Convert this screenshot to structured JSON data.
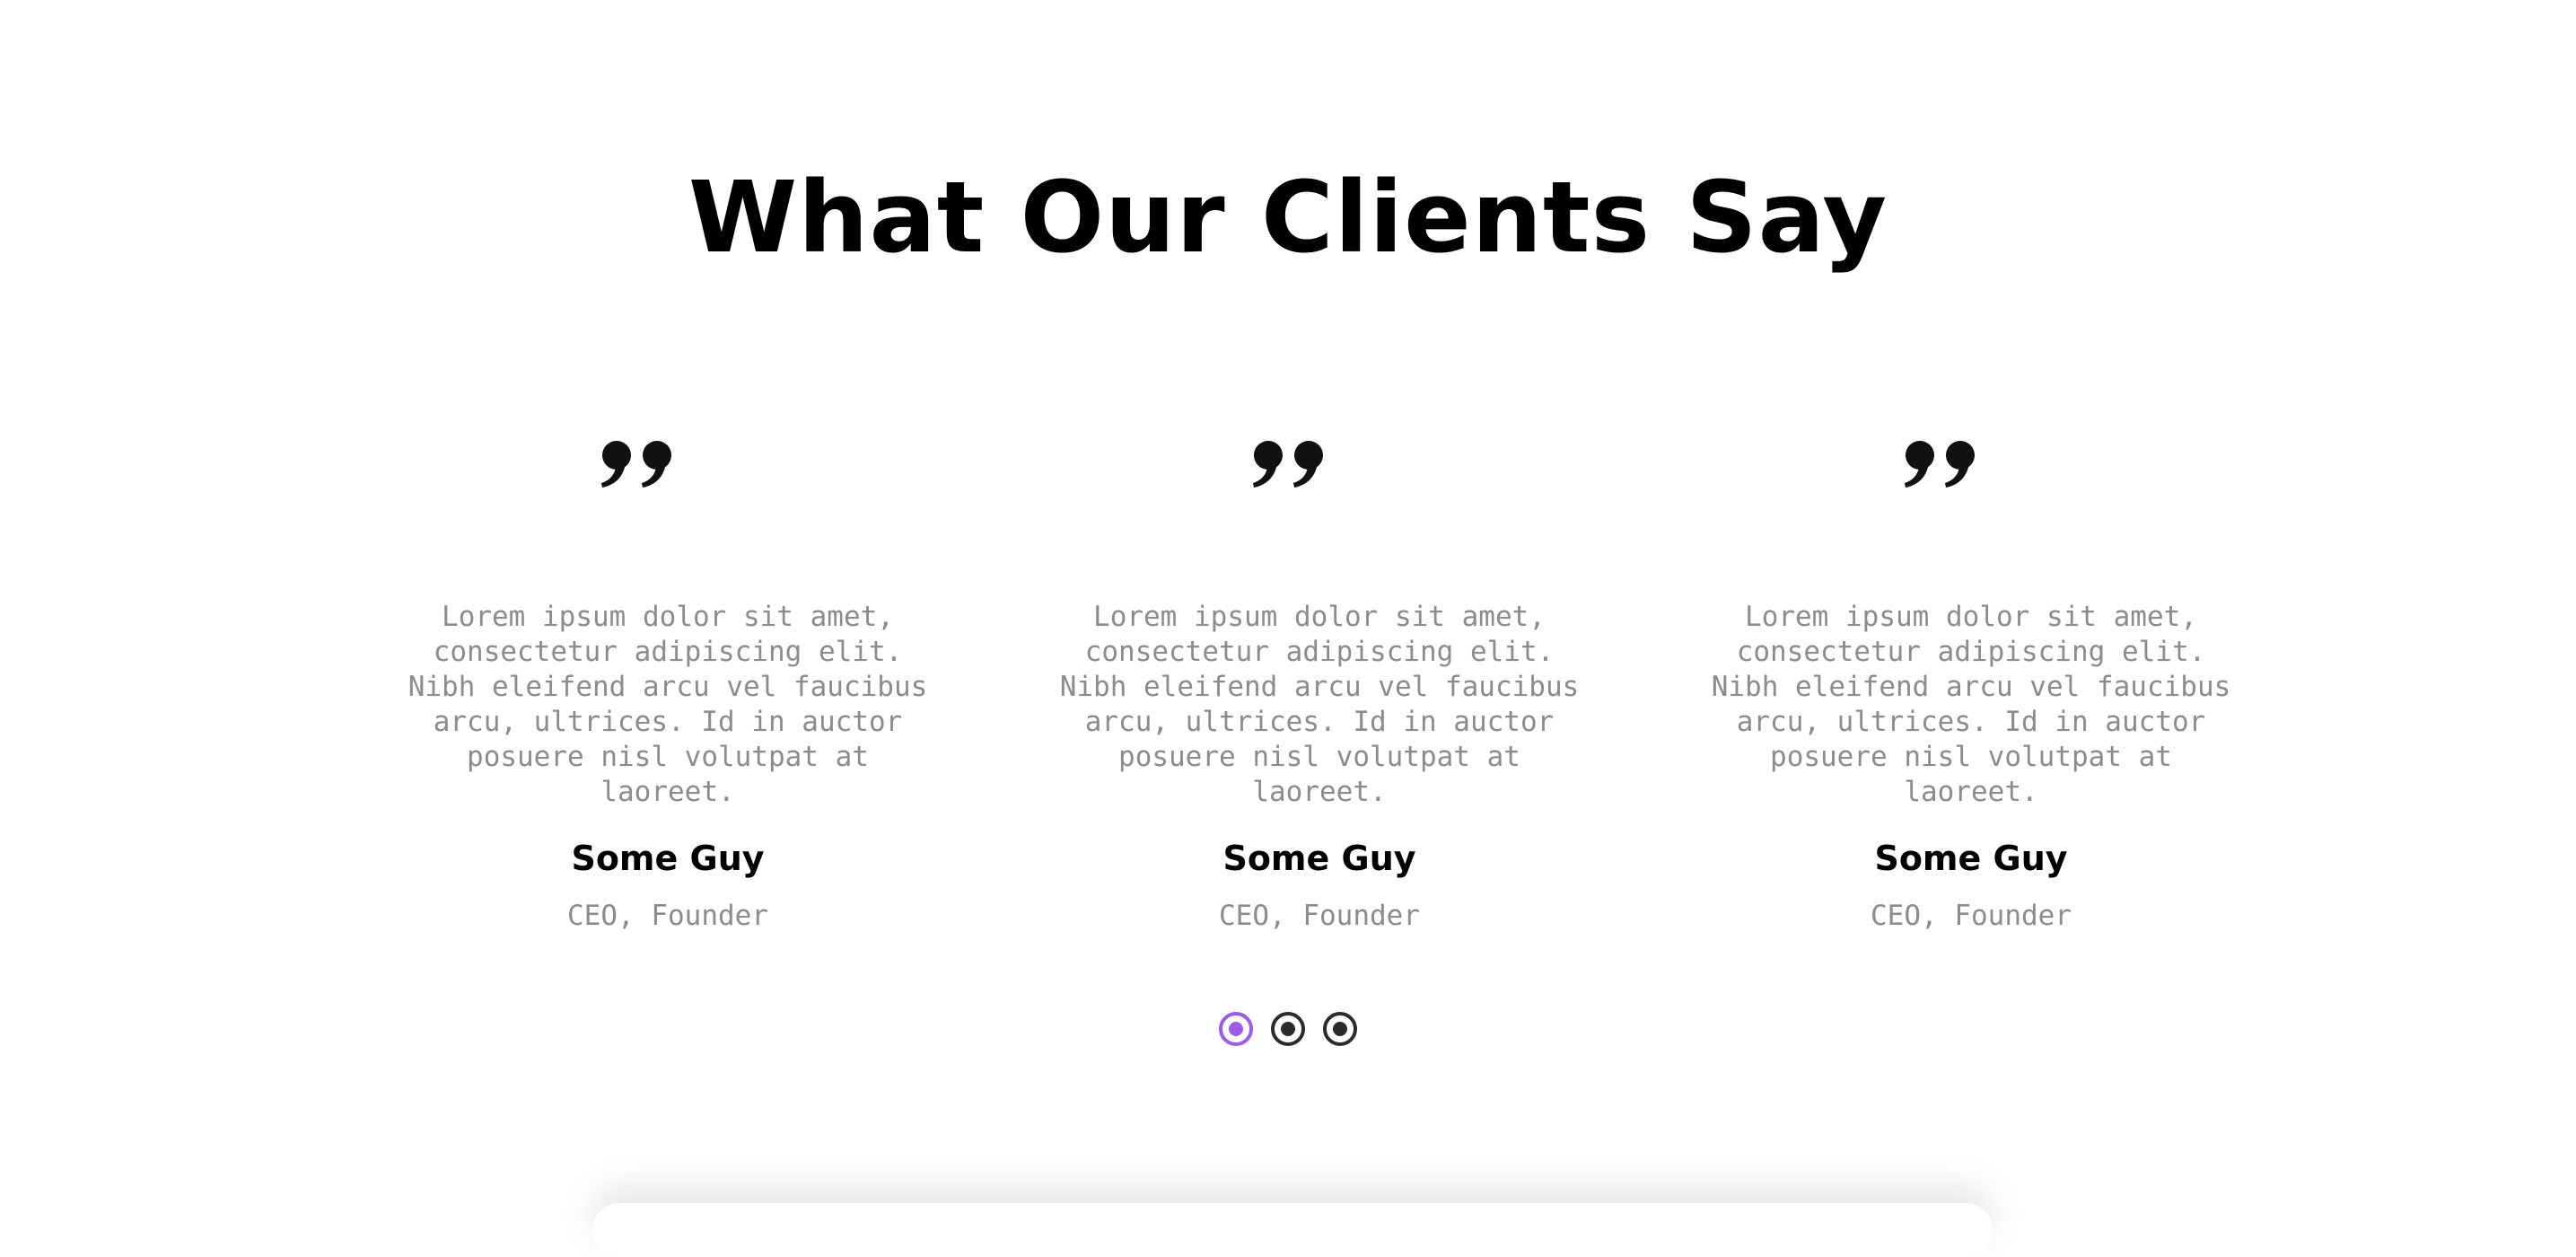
{
  "section": {
    "title": "What Our Clients Say"
  },
  "testimonials": [
    {
      "text": "Lorem ipsum dolor sit amet,\nconsectetur adipiscing elit.\nNibh eleifend arcu vel faucibus\narcu, ultrices. Id in auctor\nposuere nisl volutpat at\nlaoreet.",
      "name": "Some Guy",
      "role": "CEO, Founder",
      "icon": "quote-icon"
    },
    {
      "text": "Lorem ipsum dolor sit amet,\nconsectetur adipiscing elit.\nNibh eleifend arcu vel faucibus\narcu, ultrices. Id in auctor\nposuere nisl volutpat at\nlaoreet.",
      "name": "Some Guy",
      "role": "CEO, Founder",
      "icon": "quote-icon"
    },
    {
      "text": "Lorem ipsum dolor sit amet,\nconsectetur adipiscing elit.\nNibh eleifend arcu vel faucibus\narcu, ultrices. Id in auctor\nposuere nisl volutpat at\nlaoreet.",
      "name": "Some Guy",
      "role": "CEO, Founder",
      "icon": "quote-icon"
    }
  ],
  "carousel": {
    "slide_count": 3,
    "active_index": 0,
    "active_color": "#9b5de5",
    "inactive_color": "#2b2b2b"
  },
  "colors": {
    "title": "#000000",
    "body_text": "#8c8c8c",
    "background": "#ffffff"
  }
}
